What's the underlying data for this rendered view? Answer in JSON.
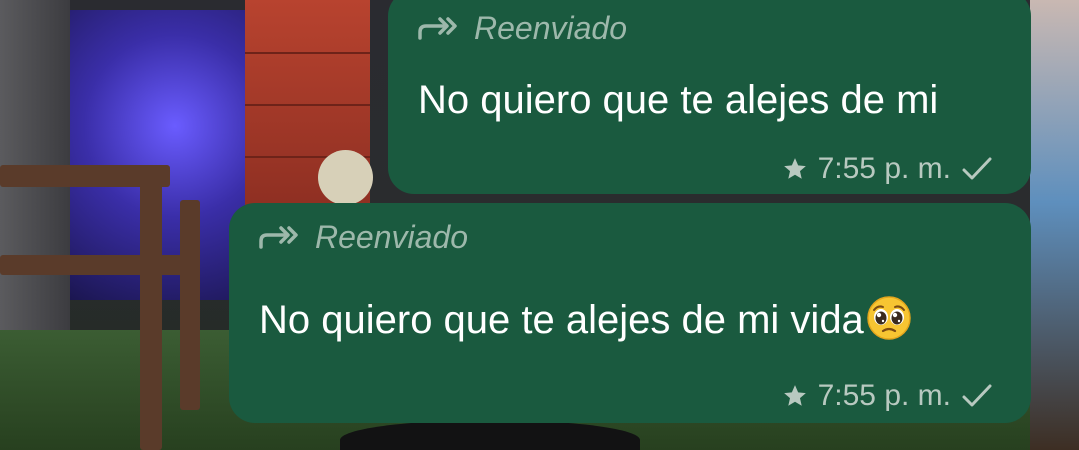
{
  "messages": [
    {
      "forwarded_label": "Reenviado",
      "text": "No quiero que te alejes de mi",
      "time": "7:55 p. m.",
      "starred": true,
      "status": "sent"
    },
    {
      "forwarded_label": "Reenviado",
      "text": "No quiero que te alejes de mi vida",
      "emoji": "pleading-face",
      "time": "7:55 p. m.",
      "starred": true,
      "status": "sent"
    }
  ],
  "colors": {
    "bubble": "#1a5a3f",
    "forwarded_text": "#9db8ab",
    "meta_text": "#b8c9c0"
  },
  "icons": {
    "forward": "forward-arrow-icon",
    "star": "star-icon",
    "check": "check-icon"
  }
}
